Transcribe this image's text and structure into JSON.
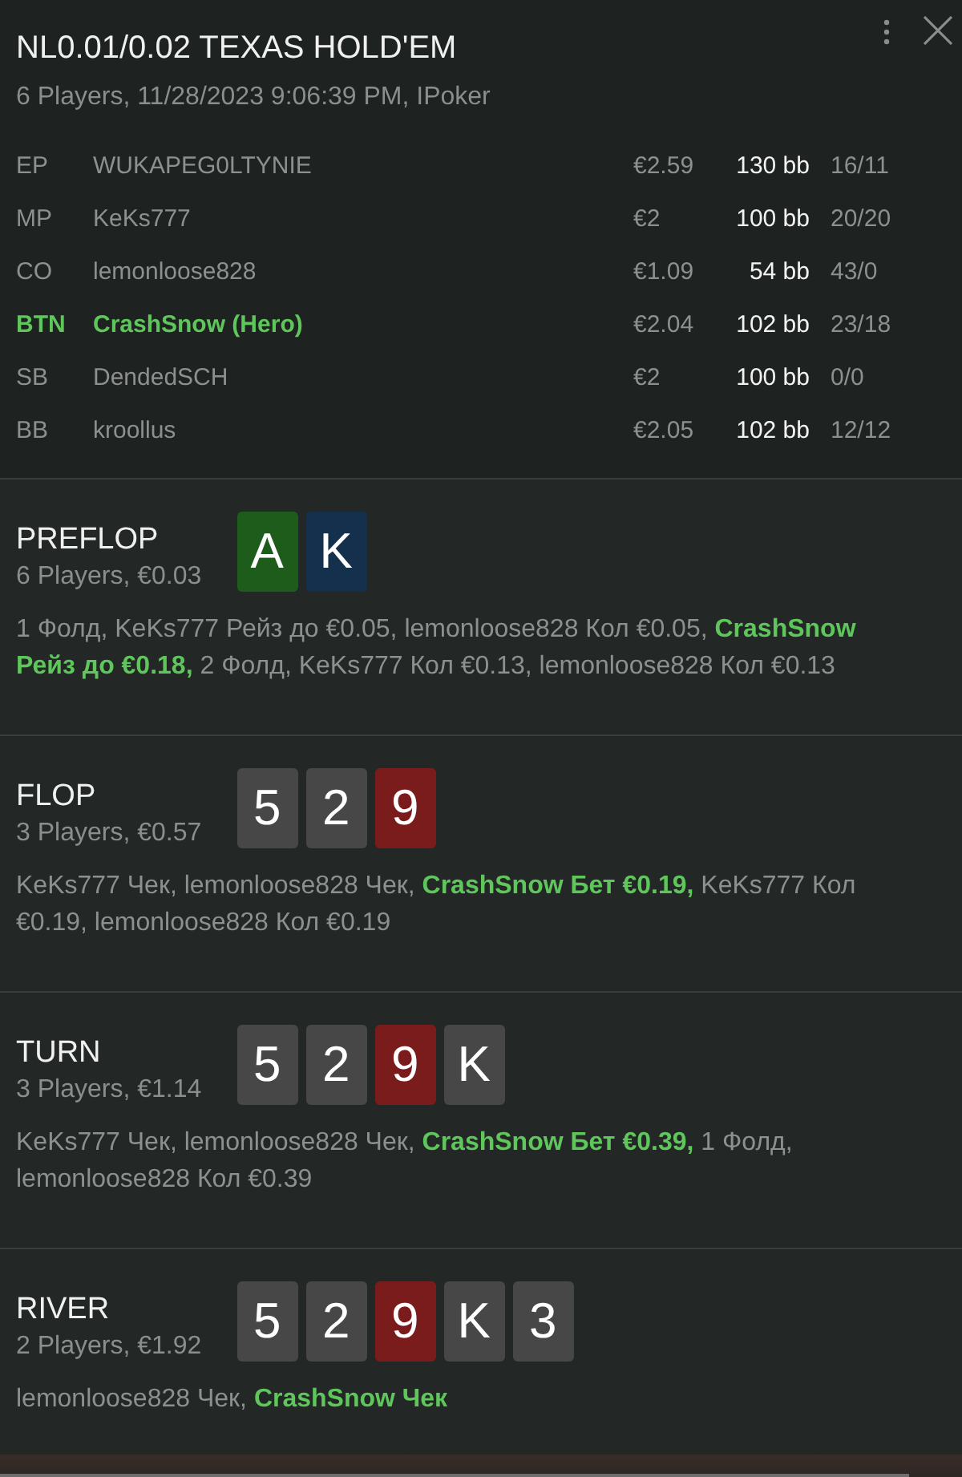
{
  "window": {
    "title": "NL0.01/0.02 TEXAS HOLD'EM",
    "subtitle": "6 Players, 11/28/2023 9:06:39 PM, IPoker"
  },
  "players": [
    {
      "position": "EP",
      "name": "WUKAPEG0LTYNIE",
      "stack": "€2.59",
      "big_blinds": "130 bb",
      "stats": "16/11",
      "hero": false
    },
    {
      "position": "MP",
      "name": "KeKs777",
      "stack": "€2",
      "big_blinds": "100 bb",
      "stats": "20/20",
      "hero": false
    },
    {
      "position": "CO",
      "name": "lemonloose828",
      "stack": "€1.09",
      "big_blinds": "54 bb",
      "stats": "43/0",
      "hero": false
    },
    {
      "position": "BTN",
      "name": "CrashSnow (Hero)",
      "stack": "€2.04",
      "big_blinds": "102 bb",
      "stats": "23/18",
      "hero": true
    },
    {
      "position": "SB",
      "name": "DendedSCH",
      "stack": "€2",
      "big_blinds": "100 bb",
      "stats": "0/0",
      "hero": false
    },
    {
      "position": "BB",
      "name": "kroollus",
      "stack": "€2.05",
      "big_blinds": "102 bb",
      "stats": "12/12",
      "hero": false
    }
  ],
  "streets": [
    {
      "name": "PREFLOP",
      "summary": "6 Players, €0.03",
      "cards": [
        {
          "rank": "A",
          "color": "#1d5c1b"
        },
        {
          "rank": "K",
          "color": "#15304d"
        }
      ],
      "actions": [
        {
          "text": "1 Фолд, KeKs777 Рейз до €0.05, lemonloose828 Кол €0.05,",
          "hero": false
        },
        {
          "text": "CrashSnow Рейз до €0.18,",
          "hero": true
        },
        {
          "text": "2 Фолд, KeKs777 Кол €0.13, lemonloose828 Кол €0.13",
          "hero": false
        }
      ]
    },
    {
      "name": "FLOP",
      "summary": "3 Players, €0.57",
      "cards": [
        {
          "rank": "5",
          "color": "#474747"
        },
        {
          "rank": "2",
          "color": "#474747"
        },
        {
          "rank": "9",
          "color": "#7a1c1c"
        }
      ],
      "actions": [
        {
          "text": "KeKs777 Чек, lemonloose828 Чек,",
          "hero": false
        },
        {
          "text": "CrashSnow Бет €0.19,",
          "hero": true
        },
        {
          "text": "KeKs777 Кол €0.19, lemonloose828 Кол €0.19",
          "hero": false
        }
      ]
    },
    {
      "name": "TURN",
      "summary": "3 Players, €1.14",
      "cards": [
        {
          "rank": "5",
          "color": "#474747"
        },
        {
          "rank": "2",
          "color": "#474747"
        },
        {
          "rank": "9",
          "color": "#7a1c1c"
        },
        {
          "rank": "K",
          "color": "#474747"
        }
      ],
      "actions": [
        {
          "text": "KeKs777 Чек, lemonloose828 Чек,",
          "hero": false
        },
        {
          "text": "CrashSnow Бет €0.39,",
          "hero": true
        },
        {
          "text": "1 Фолд, lemonloose828 Кол €0.39",
          "hero": false
        }
      ]
    },
    {
      "name": "RIVER",
      "summary": "2 Players, €1.92",
      "cards": [
        {
          "rank": "5",
          "color": "#474747"
        },
        {
          "rank": "2",
          "color": "#474747"
        },
        {
          "rank": "9",
          "color": "#7a1c1c"
        },
        {
          "rank": "K",
          "color": "#474747"
        },
        {
          "rank": "3",
          "color": "#474747"
        }
      ],
      "actions": [
        {
          "text": "lemonloose828 Чек,",
          "hero": false
        },
        {
          "text": "CrashSnow Чек",
          "hero": true
        }
      ]
    }
  ]
}
